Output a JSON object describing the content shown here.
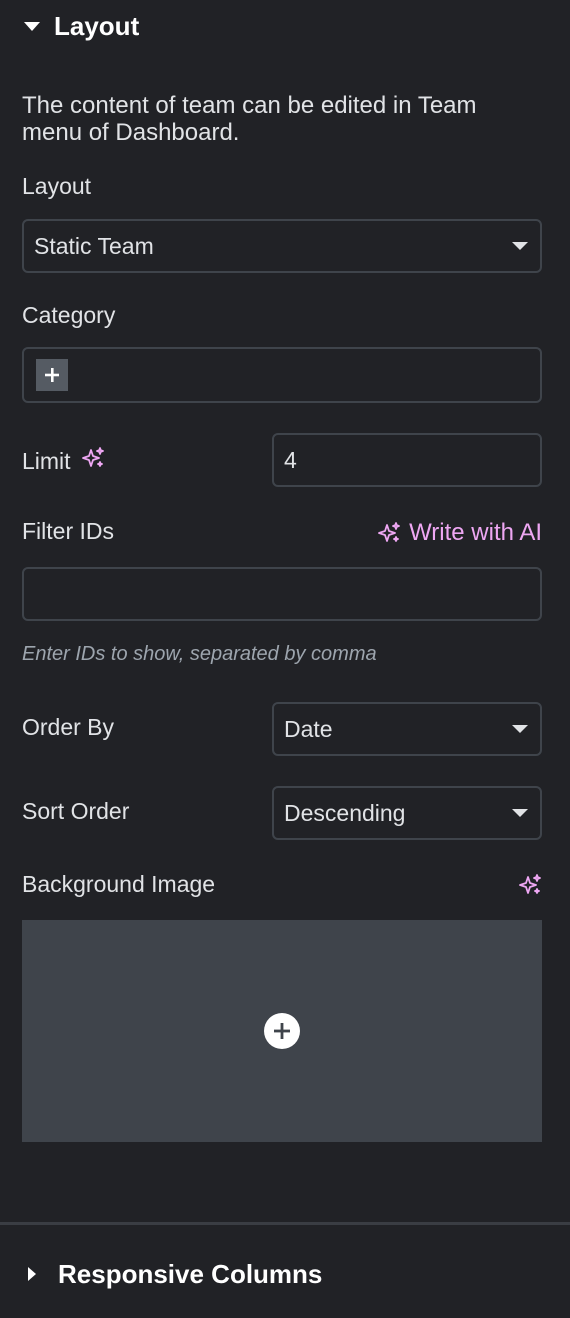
{
  "section": {
    "title": "Layout",
    "expanded": true
  },
  "description": "The content of team can be edited in Team menu of Dashboard.",
  "layout": {
    "label": "Layout",
    "value": "Static Team"
  },
  "category": {
    "label": "Category"
  },
  "limit": {
    "label": "Limit",
    "value": "4",
    "icon": "ai-sparkle-icon"
  },
  "filter_ids": {
    "label": "Filter IDs",
    "ai_label": "Write with AI",
    "value": "",
    "hint": "Enter IDs to show, separated by comma"
  },
  "order_by": {
    "label": "Order By",
    "value": "Date"
  },
  "sort_order": {
    "label": "Sort Order",
    "value": "Descending"
  },
  "background_image": {
    "label": "Background Image",
    "icon": "ai-sparkle-icon"
  },
  "responsive_section": {
    "title": "Responsive Columns",
    "expanded": false
  },
  "colors": {
    "background": "#212226",
    "ai_accent": "#eea7f3",
    "field_border": "#3f444b",
    "media_bg": "#3f444b"
  }
}
